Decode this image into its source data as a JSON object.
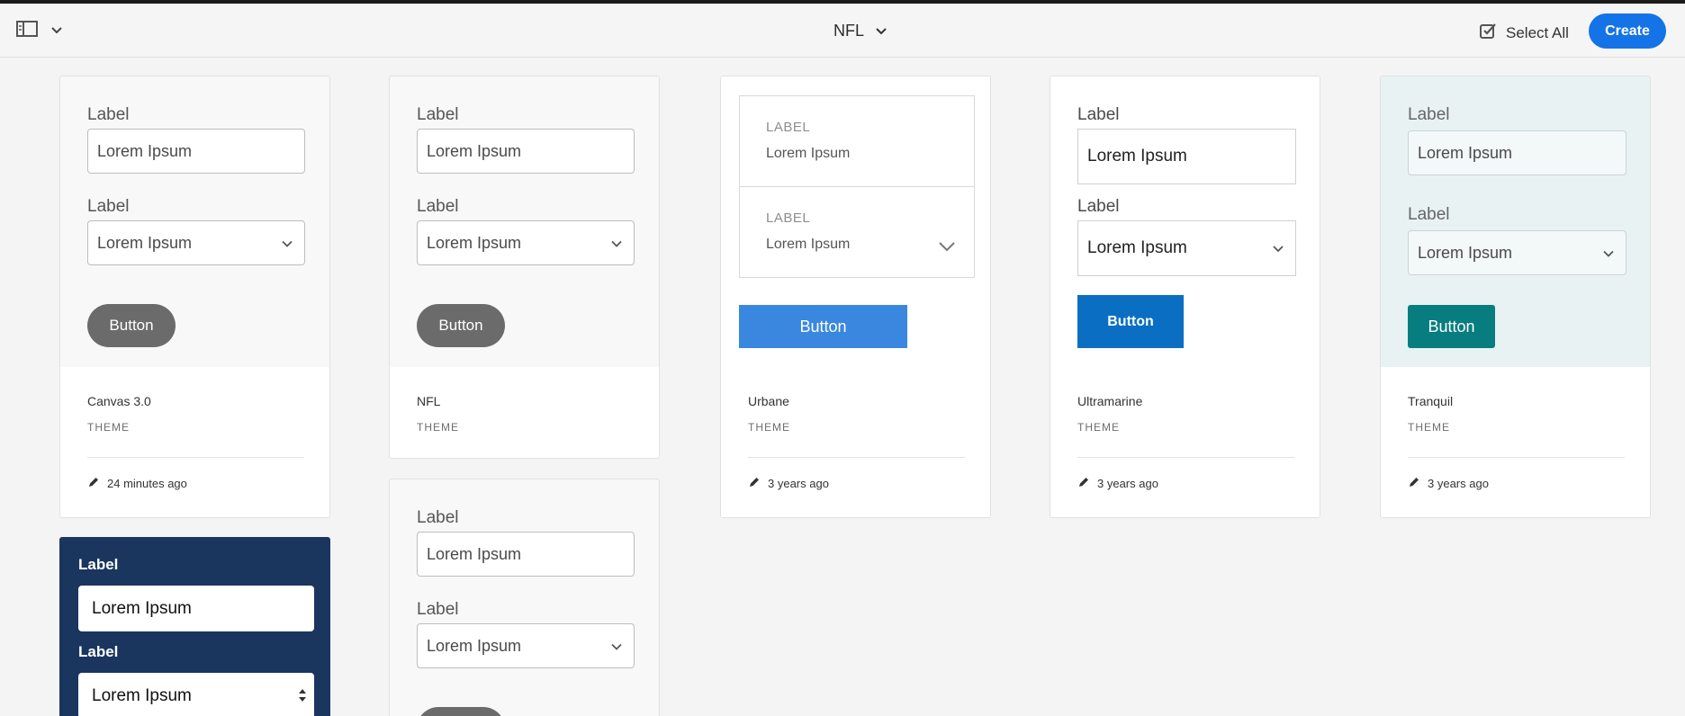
{
  "header": {
    "title": "NFL",
    "select_all": "Select All",
    "create": "Create"
  },
  "cards": [
    {
      "name": "Canvas 3.0",
      "kind": "THEME",
      "modified": "24 minutes ago",
      "preview": {
        "label1": "Label",
        "value1": "Lorem Ipsum",
        "label2": "Label",
        "value2": "Lorem Ipsum",
        "button": "Button"
      }
    },
    {
      "name": "NFL",
      "kind": "THEME",
      "modified": "",
      "preview": {
        "label1": "Label",
        "value1": "Lorem Ipsum",
        "label2": "Label",
        "value2": "Lorem Ipsum",
        "button": "Button"
      }
    },
    {
      "name": "Urbane",
      "kind": "THEME",
      "modified": "3 years ago",
      "preview": {
        "label1": "LABEL",
        "value1": "Lorem Ipsum",
        "label2": "LABEL",
        "value2": "Lorem Ipsum",
        "button": "Button"
      }
    },
    {
      "name": "Ultramarine",
      "kind": "THEME",
      "modified": "3 years ago",
      "preview": {
        "label1": "Label",
        "value1": "Lorem Ipsum",
        "label2": "Label",
        "value2": "Lorem Ipsum",
        "button": "Button"
      }
    },
    {
      "name": "Tranquil",
      "kind": "THEME",
      "modified": "3 years ago",
      "preview": {
        "label1": "Label",
        "value1": "Lorem Ipsum",
        "label2": "Label",
        "value2": "Lorem Ipsum",
        "button": "Button"
      }
    },
    {
      "name": "",
      "kind": "",
      "modified": "",
      "preview": {
        "label1": "Label",
        "value1": "Lorem Ipsum",
        "label2": "Label",
        "value2": "Lorem Ipsum",
        "button": ""
      }
    },
    {
      "name": "",
      "kind": "",
      "modified": "",
      "preview": {
        "label1": "Label",
        "value1": "Lorem Ipsum",
        "label2": "Label",
        "value2": "Lorem Ipsum",
        "button": ""
      }
    }
  ],
  "colors": {
    "accent": "#1473e6",
    "gray_button": "#6b6b6b",
    "urbane_button": "#3a87e0",
    "ultramarine_button": "#0a6fc2",
    "tranquil_button": "#077d80",
    "tranquil_bg": "#e8f2f3",
    "navy_bg": "#1a365f"
  },
  "icons": {
    "rail": "panel-toggle-icon",
    "chevron": "chevron-down-icon",
    "checkbox": "checkbox-checked-icon",
    "edit": "pencil-icon",
    "stepper": "select-arrows-icon"
  }
}
